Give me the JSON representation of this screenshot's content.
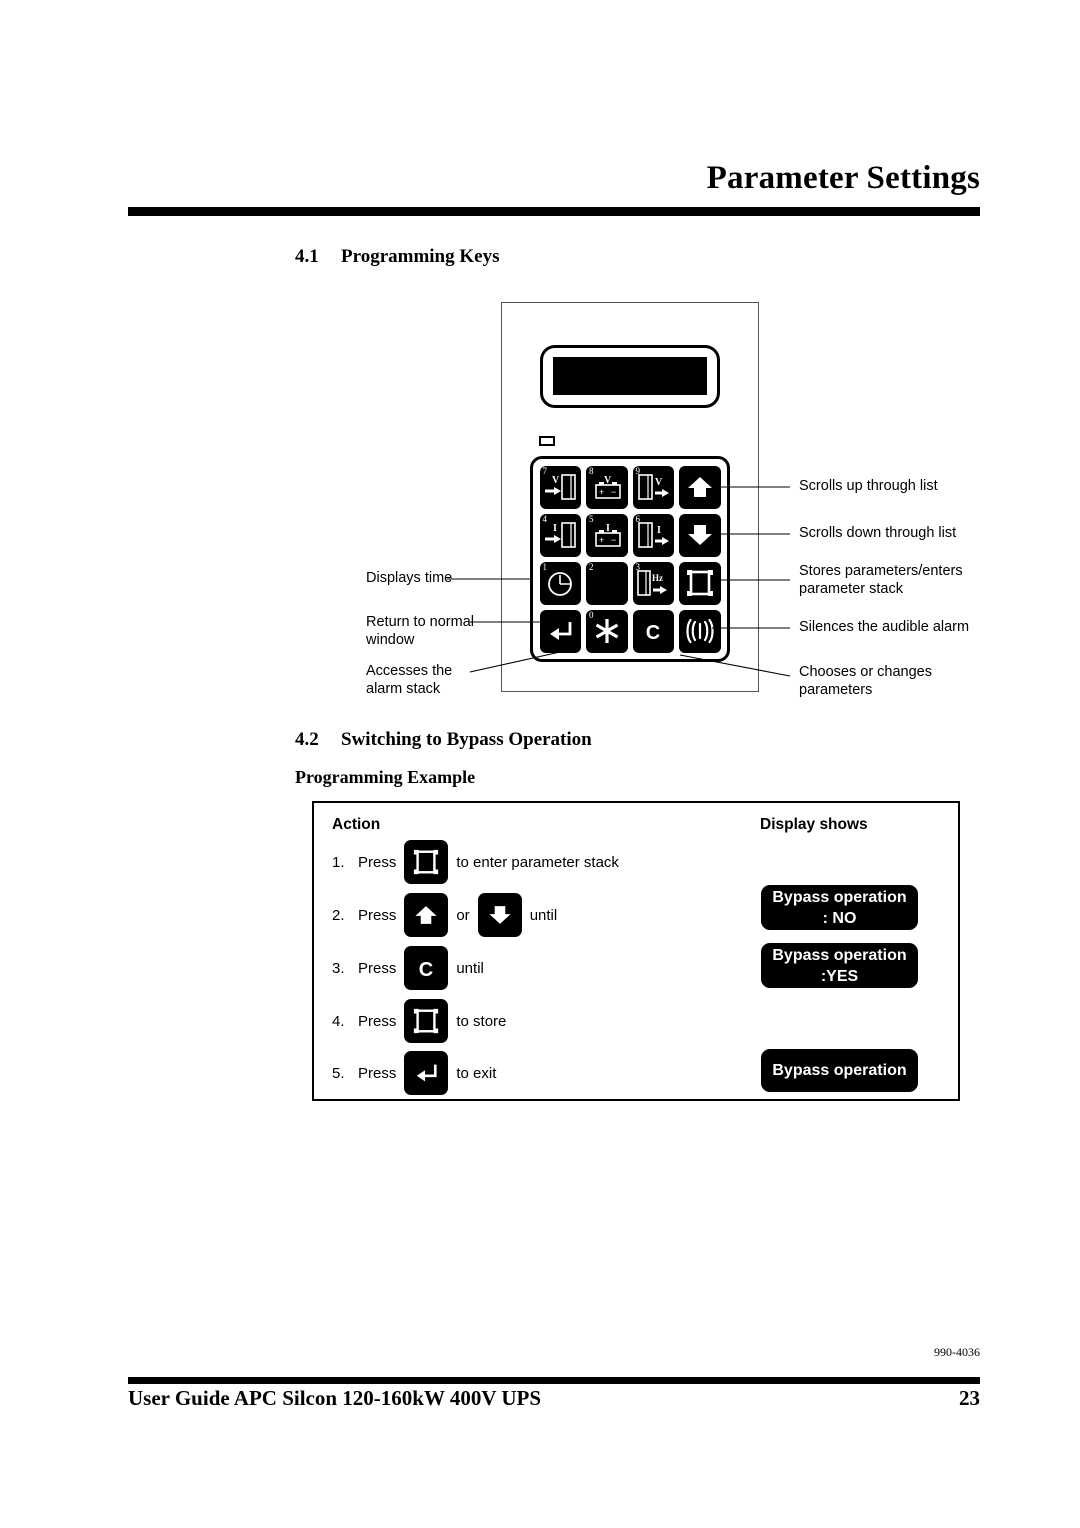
{
  "header": {
    "chapter_title": "Parameter Settings"
  },
  "sections": {
    "s41": {
      "number": "4.1",
      "title": "Programming Keys"
    },
    "s42": {
      "number": "4.2",
      "title": "Switching to Bypass Operation"
    },
    "sub": "Programming Example"
  },
  "panel": {
    "keys": [
      {
        "num": "7",
        "icon": "voltage-input-cabinet-icon",
        "label": "V"
      },
      {
        "num": "8",
        "icon": "battery-voltage-icon",
        "label": "V"
      },
      {
        "num": "9",
        "icon": "voltage-output-cabinet-icon",
        "label": "V"
      },
      {
        "num": "",
        "icon": "arrow-up-icon",
        "label": ""
      },
      {
        "num": "4",
        "icon": "current-input-cabinet-icon",
        "label": "I"
      },
      {
        "num": "5",
        "icon": "battery-current-icon",
        "label": "I"
      },
      {
        "num": "6",
        "icon": "current-output-cabinet-icon",
        "label": "I"
      },
      {
        "num": "",
        "icon": "arrow-down-icon",
        "label": ""
      },
      {
        "num": "1",
        "icon": "clock-icon",
        "label": ""
      },
      {
        "num": "2",
        "icon": "blank-icon",
        "label": ""
      },
      {
        "num": "3",
        "icon": "frequency-output-cabinet-icon",
        "label": "Hz"
      },
      {
        "num": "",
        "icon": "store-frame-icon",
        "label": ""
      },
      {
        "num": "",
        "icon": "enter-return-icon",
        "label": ""
      },
      {
        "num": "0",
        "icon": "asterisk-icon",
        "label": ""
      },
      {
        "num": "",
        "icon": "letter-c-icon",
        "label": "C"
      },
      {
        "num": "",
        "icon": "alarm-sound-icon",
        "label": ""
      }
    ]
  },
  "annotations": {
    "left": [
      "Displays time",
      "Return to normal\nwindow",
      "Accesses the\nalarm stack"
    ],
    "right": [
      "Scrolls up through list",
      "Scrolls down through list",
      "Stores parameters/enters\nparameter stack",
      "Silences the audible alarm",
      "Chooses or changes\nparameters"
    ]
  },
  "example": {
    "col_action": "Action",
    "col_display": "Display shows",
    "press_word": "Press",
    "or_word": "or",
    "steps": [
      {
        "index": "1.",
        "icon": "store-frame-icon",
        "tail": "to enter parameter stack"
      },
      {
        "index": "2.",
        "icon": "arrow-up-icon",
        "icon2": "arrow-down-icon",
        "tail": "until"
      },
      {
        "index": "3.",
        "icon": "letter-c-icon",
        "tail": "until"
      },
      {
        "index": "4.",
        "icon": "store-frame-icon",
        "tail": "to store"
      },
      {
        "index": "5.",
        "icon": "enter-return-icon",
        "tail": "to exit"
      }
    ],
    "displays": [
      {
        "line1": "Bypass operation",
        "line2": ": NO"
      },
      {
        "line1": "Bypass operation",
        "line2": ":YES"
      },
      {
        "line1": "Bypass operation",
        "line2": ""
      }
    ]
  },
  "footer": {
    "doc_number": "990-4036",
    "guide_title": "User Guide APC Silcon 120-160kW 400V UPS",
    "page_number": "23"
  }
}
